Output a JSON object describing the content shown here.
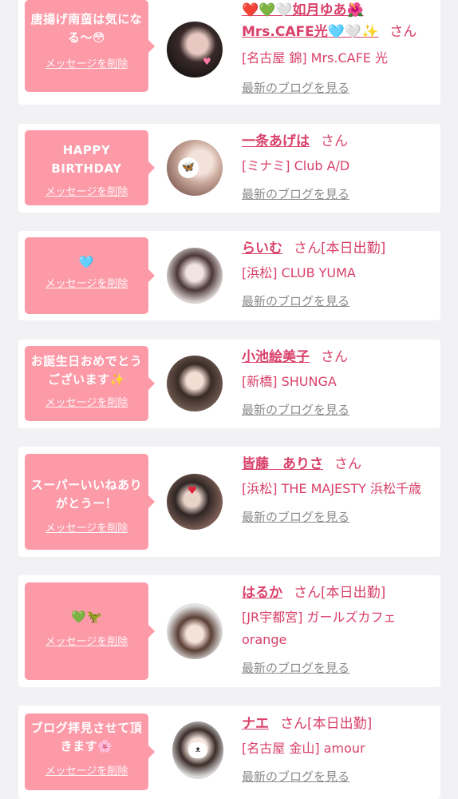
{
  "delete_label": "メッセージを削除",
  "blog_label": "最新のブログを見る",
  "san": "さん",
  "colors": {
    "accent": "#d9406a",
    "bubble": "#fc9aa8",
    "background": "#f2f2f4"
  },
  "cards": [
    {
      "message": "唐揚げ南蛮は気になる〜😳",
      "name": "❤️💚🤍如月ゆあ🌺Mrs.CAFE光🩵🤍✨",
      "status": "",
      "shop": "[名古屋 錦] Mrs.CAFE 光"
    },
    {
      "message": "HAPPY BIRTHDAY",
      "name": "一条あげは",
      "status": "",
      "shop": "[ミナミ] Club A/D"
    },
    {
      "message": "🩵",
      "name": "らいむ",
      "status": "[本日出勤]",
      "shop": "[浜松] CLUB YUMA"
    },
    {
      "message": "お誕生日おめでとうございます✨",
      "name": "小池絵美子",
      "status": "",
      "shop": "[新橋] SHUNGA"
    },
    {
      "message": "スーパーいいねありがとうー！",
      "name": "皆藤　ありさ",
      "status": "",
      "shop": "[浜松] THE MAJESTY 浜松千歳"
    },
    {
      "message": "💚🦖",
      "name": "はるか",
      "status": "[本日出勤]",
      "shop": "[JR宇都宮] ガールズカフェorange"
    },
    {
      "message": "ブログ拝見させて頂きます🌸",
      "name": "ナエ",
      "status": "[本日出勤]",
      "shop": "[名古屋 金山] amour"
    }
  ]
}
